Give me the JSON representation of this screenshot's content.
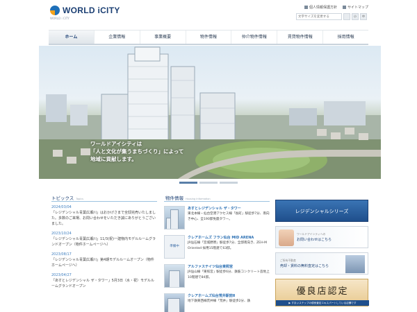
{
  "header": {
    "logo_text": "WORLD iCITY",
    "logo_sub": "WORLD i CITY",
    "util_links": [
      "個人情報保護方針",
      "サイトマップ"
    ],
    "search_placeholder": "文字サイズを変更する",
    "size_labels": [
      "小",
      "中"
    ]
  },
  "nav": {
    "items": [
      "ホーム",
      "企業情報",
      "事業概要",
      "物件情報",
      "仲介物件情報",
      "賃貸物件情報",
      "採用情報"
    ],
    "active_index": 0
  },
  "hero": {
    "caption_lines": [
      "ワールドアイシティは",
      "「人と文化が集うまちづくり」によって",
      "地域に貢献します。"
    ],
    "slide_count": 3,
    "active_slide": 0
  },
  "topics": {
    "title": "トピックス",
    "subtitle": "Topics",
    "items": [
      {
        "date": "2024/03/04",
        "text": "「レジデンシャル青葉広瀬川」はおかげさまで全邸完売いたしました。多数のご来場、お問い合わせをいただき誠にありがとうございました。"
      },
      {
        "date": "2023/10/24",
        "text": "「レジデンシャル青葉広瀬川」11/3(祝)一建物内モデルルームグランドオープン（物件ホームページへ）"
      },
      {
        "date": "2023/08/17",
        "text": "「レジデンシャル青葉広瀬川」第4期モデルルームオープン（物件ホームページへ）"
      },
      {
        "date": "2023/04/27",
        "text": "「あすとレジデンシャル ザ・タワー」5月3日（水・祝）モデルルームグランドオープン"
      }
    ]
  },
  "properties": {
    "title": "物件情報",
    "subtitle": "Housing Information",
    "items": [
      {
        "title": "あすとレジデンシャル ザ・タワー",
        "desc": "東北本線・仙台空港アクセス線「長町」駅徒歩7分、南向き中心、全190邸免震タワー。",
        "thumb_label": ""
      },
      {
        "title": "クレアホームズ フラン仙台 MID ARENA",
        "desc": "JR仙石線「宮城野原」駅徒歩7分、全邸南向き、ZEH-M Oriented 採用15階建て63邸。",
        "thumb_label": "準備中"
      },
      {
        "title": "アルファステイツ仙台東照宮",
        "desc": "JR仙山線「東照宮」駅徒歩6分、鉄筋コンクリート造地上10階建で84邸。",
        "thumb_label": ""
      },
      {
        "title": "クレアホームズ仙台荒井駅前Ⅱ",
        "desc": "地下鉄東西線荒井線「荒井」駅徒歩2分、鉄",
        "thumb_label": ""
      }
    ]
  },
  "banners": {
    "main": "レジデンシャルシリーズ",
    "contact_small": "ワールドアイシティへの",
    "contact_big": "お問い合わせはこちら",
    "appraisal_small": "ご所有不動産",
    "appraisal_big": "売却・賃料の無料査定はこちら",
    "award_title": "優良店認定",
    "award_sub": "▶ すまいステップの優良査定エキスパートしている店舗です"
  }
}
